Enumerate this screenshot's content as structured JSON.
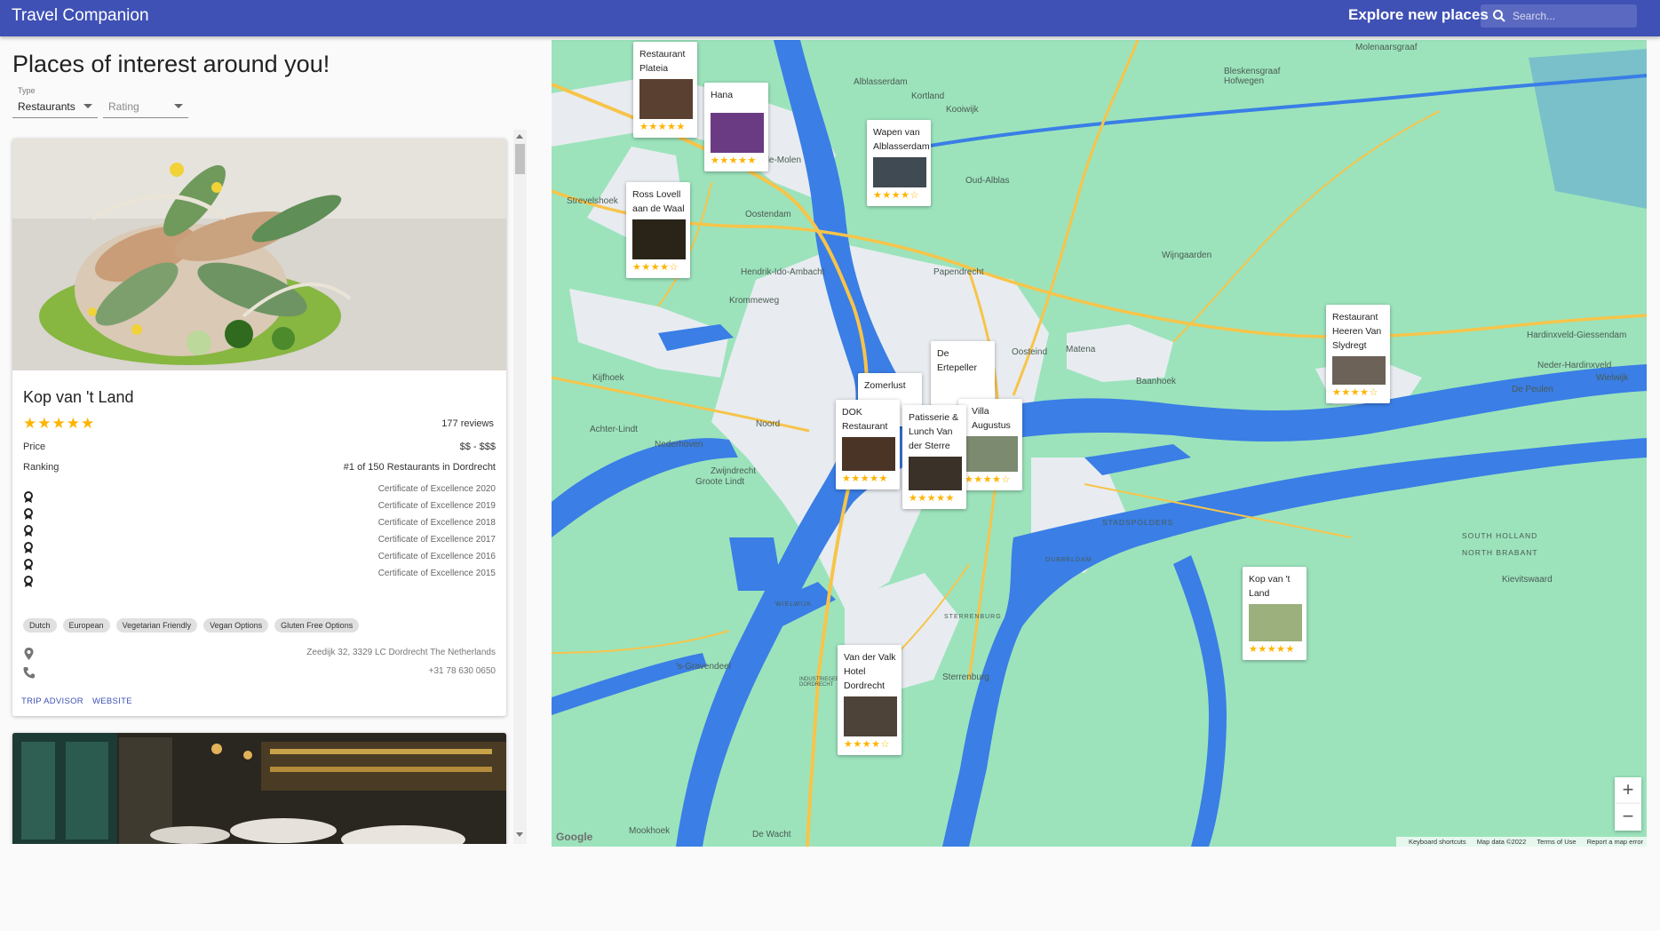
{
  "app": {
    "title": "Travel Companion",
    "explore": "Explore new places",
    "search_placeholder": "Search..."
  },
  "heading": "Places of interest around you!",
  "filters": {
    "type_label": "Type",
    "type_value": "Restaurants",
    "rating_placeholder": "Rating"
  },
  "card": {
    "name": "Kop van 't Land",
    "stars": "★★★★★",
    "rating": 5,
    "reviews": "177 reviews",
    "price_label": "Price",
    "price_value": "$$ - $$$",
    "ranking_label": "Ranking",
    "ranking_value": "#1 of 150 Restaurants in Dordrecht",
    "awards": [
      "Certificate of Excellence 2020",
      "Certificate of Excellence 2019",
      "Certificate of Excellence 2018",
      "Certificate of Excellence 2017",
      "Certificate of Excellence 2016",
      "Certificate of Excellence 2015"
    ],
    "cuisines": [
      "Dutch",
      "European",
      "Vegetarian Friendly",
      "Vegan Options",
      "Gluten Free Options"
    ],
    "address": "Zeedijk 32, 3329 LC Dordrecht The Netherlands",
    "phone": "+31 78 630 0650",
    "trip_advisor": "TRIP ADVISOR",
    "website": "WEBSITE"
  },
  "map": {
    "places": [
      "Molenaarsgraaf",
      "Bleskensgraaf\nHofwegen",
      "Alblasserdam",
      "Kortland",
      "Kooiwijk",
      "Oude-Molen",
      "Oud-Alblas",
      "Strevelshoek",
      "Oostendam",
      "Hendrik-Ido-Ambacht",
      "Krommeweg",
      "Papendrecht",
      "Wijngaarden",
      "Hardinxveld-Giessendam",
      "Neder-Hardinxveld",
      "Wielwijk",
      "Oosteind",
      "Matena",
      "Baanhoek",
      "De Peulen",
      "Kijfhoek",
      "Noord",
      "Achter-Lindt",
      "Nederhoven",
      "Zwijndrecht",
      "Groote Lindt",
      "STADSPOLDERS",
      "SOUTH HOLLAND",
      "NORTH BRABANT",
      "Kievitswaard",
      "DUBBELDAM",
      "WIELWIJK",
      "STERRENBURG",
      "Sterrenburg",
      "'s-Gravendeel",
      "Mookhoek",
      "De Wacht",
      "INDUSTRIEGEBIED\nDORDRECHT"
    ],
    "markers": [
      {
        "name": "Restaurant Plateia",
        "stars": "★★★★★"
      },
      {
        "name": "Hana",
        "stars": "★★★★★"
      },
      {
        "name": "Wapen van Alblasserdam",
        "stars": "★★★★☆"
      },
      {
        "name": "Ross Lovell aan de Waal",
        "stars": "★★★★☆"
      },
      {
        "name": "De Ertepeller",
        "stars": "★★★★★"
      },
      {
        "name": "Zomerlust",
        "stars": "★★★★★"
      },
      {
        "name": "Villa Augustus",
        "stars": "★★★★☆"
      },
      {
        "name": "DOK Restaurant",
        "stars": "★★★★★"
      },
      {
        "name": "Patisserie & Lunch Van der Sterre",
        "stars": "★★★★★"
      },
      {
        "name": "Restaurant Heeren Van Slydregt",
        "stars": "★★★★☆"
      },
      {
        "name": "Kop van 't Land",
        "stars": "★★★★★"
      },
      {
        "name": "Van der Valk Hotel Dordrecht",
        "stars": "★★★★☆"
      }
    ],
    "zoom_in": "+",
    "zoom_out": "−",
    "google": "Google",
    "footer": [
      "Keyboard shortcuts",
      "Map data ©2022",
      "Terms of Use",
      "Report a map error"
    ]
  },
  "colors": {
    "appbar": "#3f51b5",
    "star": "#ffb400",
    "water": "#3a7ee6",
    "land": "#9ce3bc",
    "urban": "#e8ecf0",
    "road": "#f7c44a"
  }
}
